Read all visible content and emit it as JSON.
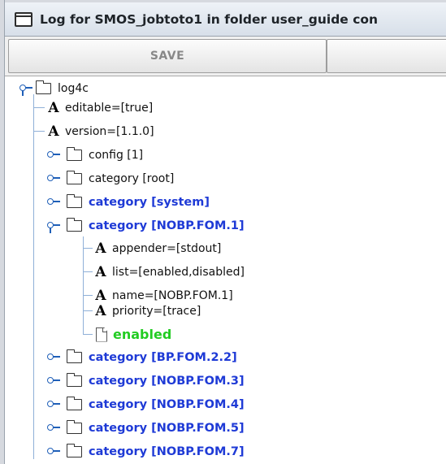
{
  "window": {
    "title": "Log for SMOS_jobtoto1 in folder user_guide con"
  },
  "toolbar": {
    "save_label": "SAVE"
  },
  "tree": {
    "root": {
      "label": "log4c",
      "expanded": true
    },
    "root_children": [
      {
        "type": "attribute",
        "label": "editable=[true]"
      },
      {
        "type": "attribute",
        "label": "version=[1.1.0]"
      },
      {
        "type": "folder",
        "label": "config [1]",
        "style": "normal",
        "expanded": false
      },
      {
        "type": "folder",
        "label": "category [root]",
        "style": "normal",
        "expanded": false
      },
      {
        "type": "folder",
        "label": "category [system]",
        "style": "bold-blue",
        "expanded": false
      },
      {
        "type": "folder",
        "label": "category [NOBP.FOM.1]",
        "style": "bold-blue",
        "expanded": true
      },
      {
        "type": "folder",
        "label": "category [BP.FOM.2.2]",
        "style": "bold-blue",
        "expanded": false
      },
      {
        "type": "folder",
        "label": "category [NOBP.FOM.3]",
        "style": "bold-blue",
        "expanded": false
      },
      {
        "type": "folder",
        "label": "category [NOBP.FOM.4]",
        "style": "bold-blue",
        "expanded": false
      },
      {
        "type": "folder",
        "label": "category [NOBP.FOM.5]",
        "style": "bold-blue",
        "expanded": false
      },
      {
        "type": "folder",
        "label": "category [NOBP.FOM.7]",
        "style": "bold-blue",
        "expanded": false
      }
    ],
    "expanded_children": [
      {
        "type": "attribute",
        "label": "appender=[stdout]"
      },
      {
        "type": "attribute",
        "label": "list=[enabled,disabled]"
      },
      {
        "type": "attribute",
        "label": "name=[NOBP.FOM.1]"
      },
      {
        "type": "attribute",
        "label": "priority=[trace]"
      },
      {
        "type": "document",
        "label": "enabled",
        "style": "green"
      }
    ]
  },
  "colors": {
    "accent_blue": "#1e3ad6",
    "enabled_green": "#22cc22",
    "tree_line": "#8fb0d8",
    "handle_blue": "#1f5fb8"
  },
  "icons": {
    "window": "window-icon",
    "folder": "folder-icon",
    "attribute": "attribute-icon",
    "document": "document-icon",
    "expand_handle": "expand-handle-icon"
  }
}
